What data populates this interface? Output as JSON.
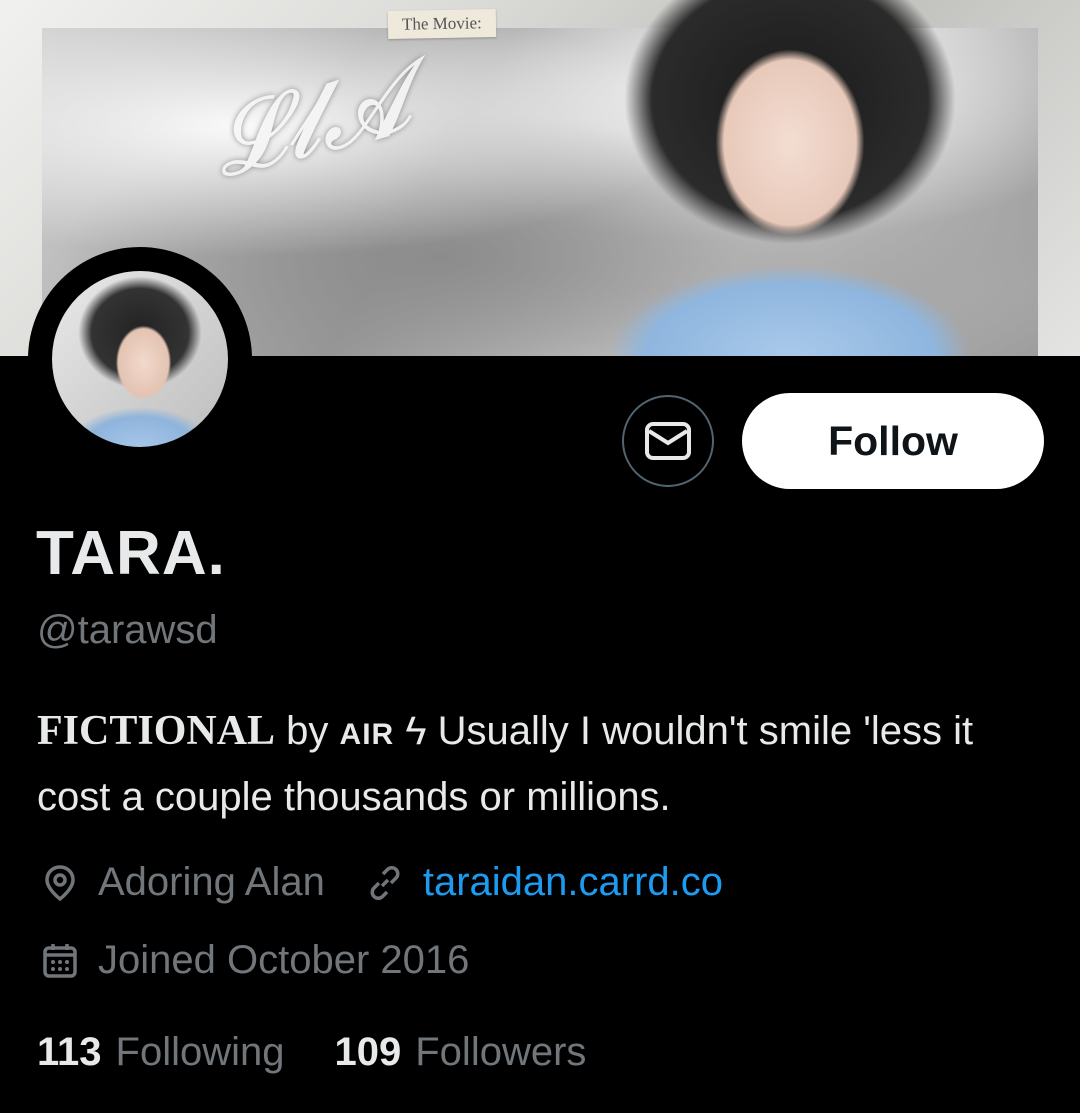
{
  "banner": {
    "tag": "The Movie:"
  },
  "actions": {
    "follow_label": "Follow"
  },
  "profile": {
    "name": "TARA.",
    "handle": "@tarawsd",
    "bio": {
      "brand": "FICTIONAL",
      "by": "by",
      "air": "AIR",
      "bolt": "ϟ",
      "text": "Usually I wouldn't smile 'less it cost a couple thousands or millions."
    },
    "location": "Adoring Alan",
    "website": "taraidan.carrd.co",
    "joined": "Joined October 2016",
    "following_count": "113",
    "following_label": "Following",
    "followers_count": "109",
    "followers_label": "Followers"
  },
  "icons": {
    "message": "envelope-icon",
    "location": "location-pin-icon",
    "link": "link-icon",
    "calendar": "calendar-icon"
  },
  "colors": {
    "background": "#000000",
    "text": "#e7e9ea",
    "secondary": "#71767b",
    "link": "#1d9bf0",
    "button_bg": "#ffffff"
  }
}
